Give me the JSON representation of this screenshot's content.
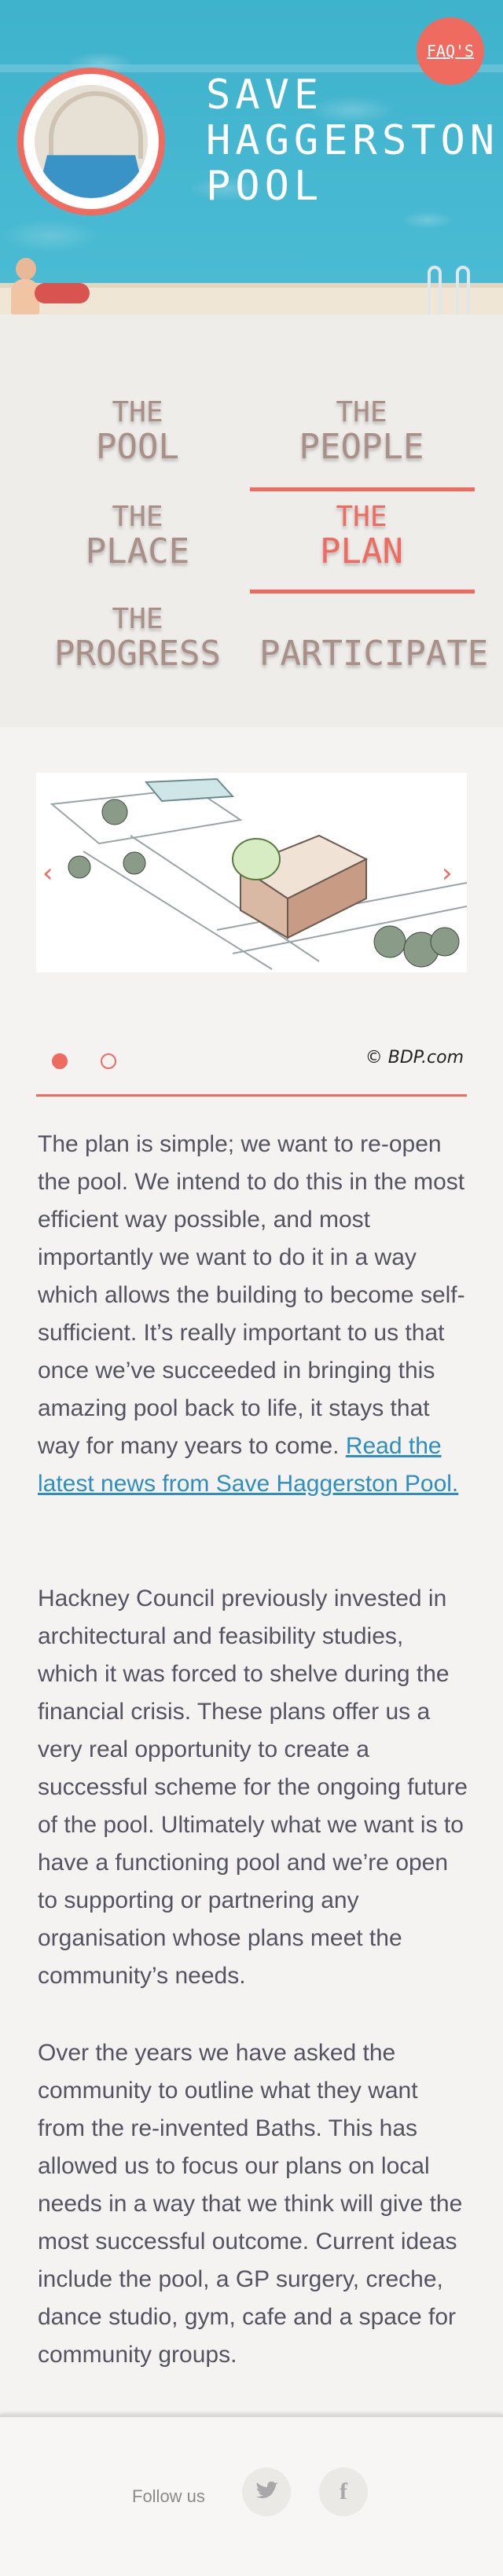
{
  "header": {
    "title_lines": [
      "SAVE",
      "HAGGERSTON",
      "POOL"
    ],
    "faq_label": "FAQ'S"
  },
  "nav": [
    {
      "top": "THE",
      "bottom": "POOL"
    },
    {
      "top": "THE",
      "bottom": "PEOPLE"
    },
    {
      "top": "THE",
      "bottom": "PLACE"
    },
    {
      "top": "THE",
      "bottom": "PLAN",
      "active": true
    },
    {
      "top": "THE",
      "bottom": "PROGRESS"
    },
    {
      "bottom": "PARTICIPATE"
    }
  ],
  "slider": {
    "credit": "© BDP.com",
    "prev_icon": "chevron-left-icon",
    "next_icon": "chevron-right-icon",
    "slide_count": 2,
    "current_slide": 1
  },
  "content": {
    "p1_text": "The plan is simple; we want to re-open the pool. We intend to do this in the most efficient way possible, and most importantly we want to do it in a way which allows the building to become self-sufficient. It’s really important to us that once we’ve succeeded in bringing this amazing pool back to life, it stays that way for many years to come.",
    "p1_link": "Read the latest news from Save Haggerston Pool.",
    "p2": "Hackney Council previously invested in architectural and feasibility studies, which it was forced to shelve during the financial crisis. These plans offer us a very real opportunity to create a successful scheme for the ongoing future of the pool. Ultimately what we want is to have a functioning pool and we’re open to supporting or partnering any organisation whose plans meet the community’s needs.",
    "p3": "Over the years we have asked the community to outline what they want from the re-invented Baths. This has allowed us to focus our plans on local needs in a way that we think will give the most successful outcome. Current ideas include the pool, a GP surgery, creche, dance studio, gym, cafe and a space for community groups."
  },
  "footer": {
    "follow_label": "Follow us",
    "social": [
      "twitter-icon",
      "facebook-icon"
    ]
  },
  "colors": {
    "accent": "#ef6b5f",
    "water": "#43b6cf",
    "text": "#545461",
    "link": "#2e8fbf",
    "nav_text": "#a98f87"
  }
}
